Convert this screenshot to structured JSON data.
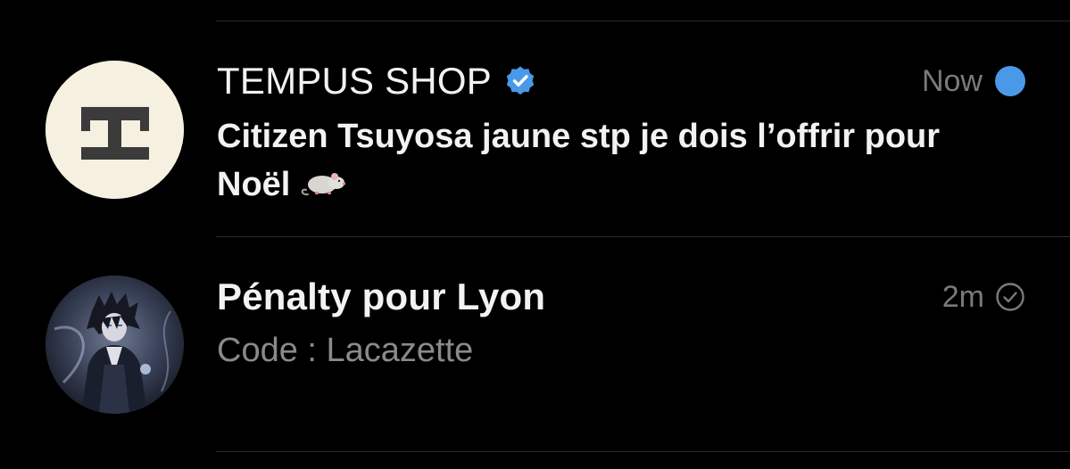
{
  "conversations": [
    {
      "name": "TEMPUS SHOP",
      "verified": true,
      "time": "Now",
      "unread": true,
      "preview": "Citizen Tsuyosa jaune stp je dois l’offrir pour Noël",
      "preview_emoji": "rat-emoji",
      "avatar": "tempus-logo"
    },
    {
      "name": "Pénalty pour Lyon",
      "verified": false,
      "time": "2m",
      "unread": false,
      "preview": "Code : Lacazette",
      "avatar": "anime-character-avatar"
    }
  ],
  "colors": {
    "background": "#000000",
    "divider": "#2b2b2b",
    "unread_dot": "#4a99e9",
    "verified_badge": "#4a99e9",
    "muted_text": "#8a8a8a",
    "timestamp": "#7a7a7a",
    "tempus_avatar_bg": "#f6f0e1"
  }
}
